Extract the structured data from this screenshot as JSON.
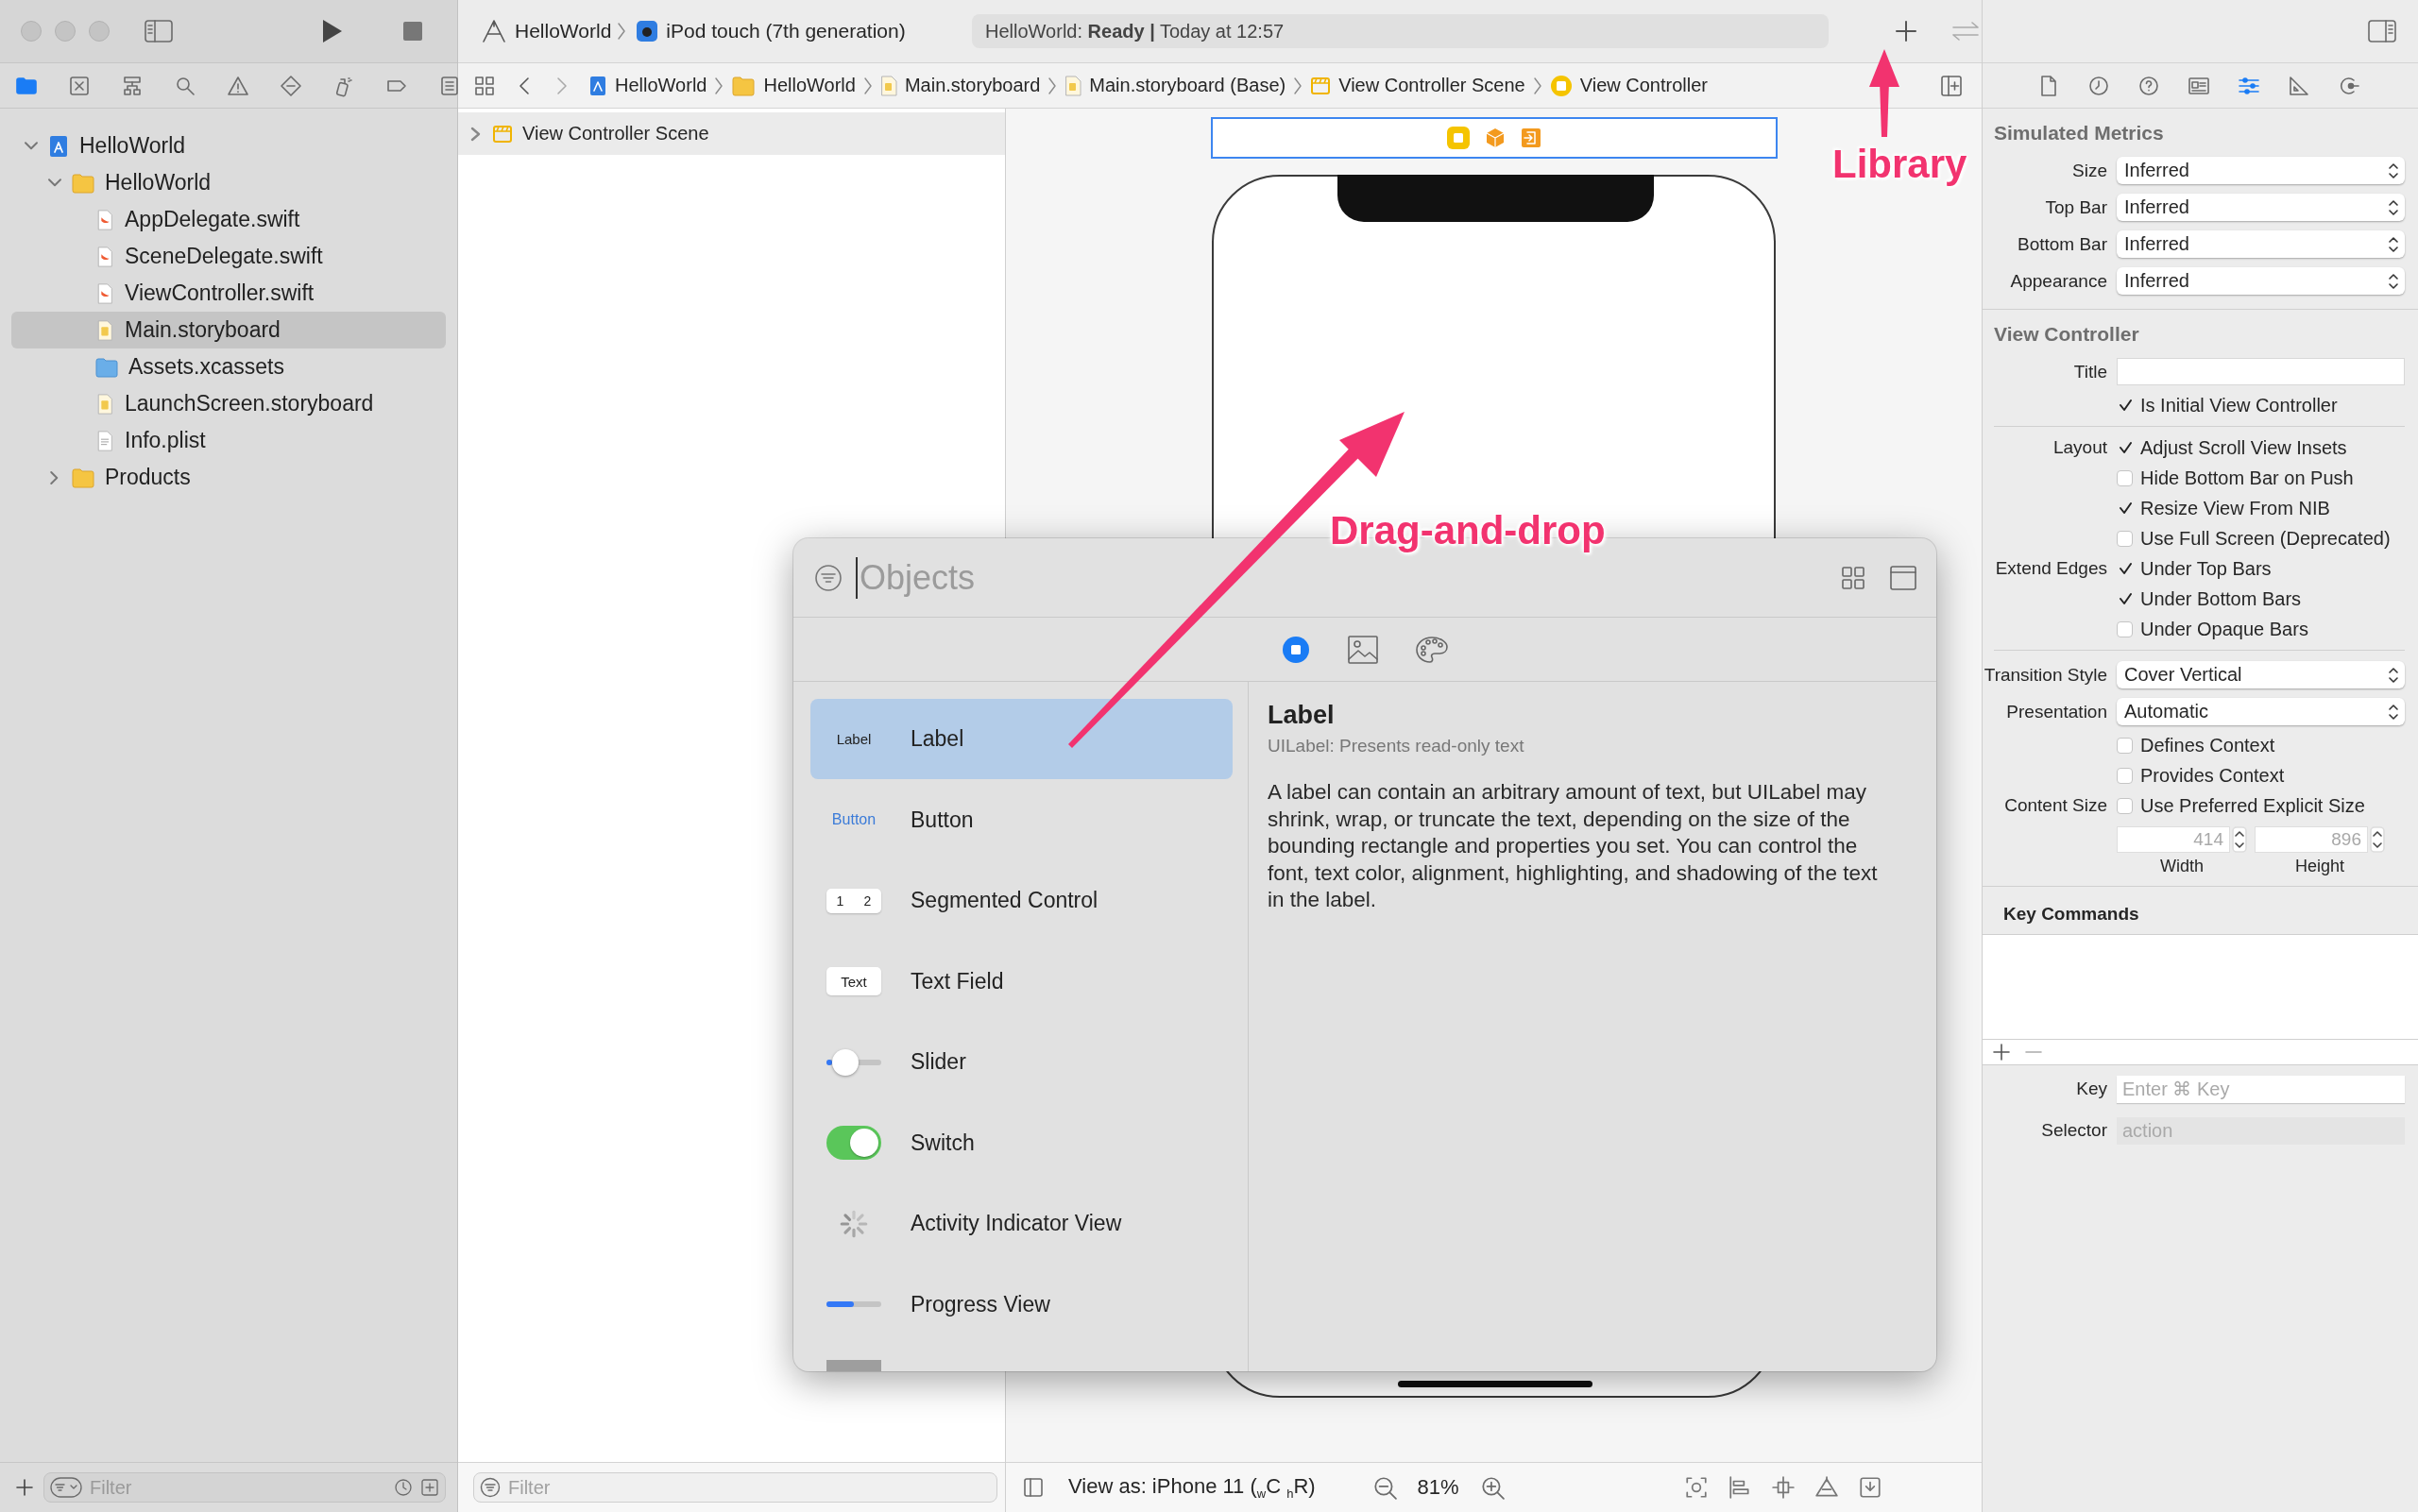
{
  "toolbar": {
    "scheme": "HelloWorld",
    "device": "iPod touch (7th generation)",
    "status": "HelloWorld: **Ready |** Today at 12:57"
  },
  "navigator": {
    "tabs": [
      {
        "kind": "folder",
        "selected": true
      },
      {
        "kind": "source-control",
        "selected": false
      },
      {
        "kind": "symbols",
        "selected": false
      },
      {
        "kind": "find",
        "selected": false
      },
      {
        "kind": "issues",
        "selected": false
      },
      {
        "kind": "tests",
        "selected": false
      },
      {
        "kind": "debug",
        "selected": false
      },
      {
        "kind": "breakpoints",
        "selected": false
      },
      {
        "kind": "reports",
        "selected": false
      }
    ],
    "tree": [
      {
        "name": "HelloWorld",
        "kind": "project",
        "expanded": true,
        "selected": false,
        "children": [
          {
            "name": "HelloWorld",
            "kind": "folder",
            "expanded": true,
            "selected": false,
            "children": [
              {
                "name": "AppDelegate.swift",
                "kind": "swift",
                "selected": false
              },
              {
                "name": "SceneDelegate.swift",
                "kind": "swift",
                "selected": false
              },
              {
                "name": "ViewController.swift",
                "kind": "swift",
                "selected": false
              },
              {
                "name": "Main.storyboard",
                "kind": "storyboard",
                "selected": true
              },
              {
                "name": "Assets.xcassets",
                "kind": "assets",
                "selected": false
              },
              {
                "name": "LaunchScreen.storyboard",
                "kind": "storyboard",
                "selected": false
              },
              {
                "name": "Info.plist",
                "kind": "plist",
                "selected": false
              }
            ]
          },
          {
            "name": "Products",
            "kind": "folder",
            "expanded": false,
            "selected": false
          }
        ]
      }
    ],
    "filter": {
      "placeholder": "Filter"
    }
  },
  "jump_bar": [
    {
      "label": "HelloWorld",
      "kind": "project"
    },
    {
      "label": "HelloWorld",
      "kind": "folder"
    },
    {
      "label": "Main.storyboard",
      "kind": "storyboard"
    },
    {
      "label": "Main.storyboard (Base)",
      "kind": "storyboard"
    },
    {
      "label": "View Controller Scene",
      "kind": "scene"
    },
    {
      "label": "View Controller",
      "kind": "controller"
    }
  ],
  "outline": {
    "items": [
      {
        "label": "View Controller Scene",
        "expanded": false
      }
    ],
    "filter": {
      "placeholder": "Filter"
    }
  },
  "canvas": {
    "view_as": "View as: iPhone 11 ($_{w}$C $_{h}$R)",
    "zoom": "81%"
  },
  "inspector": {
    "tabs": [
      {
        "kind": "file",
        "selected": false
      },
      {
        "kind": "history",
        "selected": false
      },
      {
        "kind": "help",
        "selected": false
      },
      {
        "kind": "identity",
        "selected": false
      },
      {
        "kind": "attributes",
        "selected": true
      },
      {
        "kind": "size",
        "selected": false
      },
      {
        "kind": "connections",
        "selected": false
      }
    ],
    "sections": [
      {
        "title": "Simulated Metrics",
        "rows": [
          {
            "kind": "popup",
            "label": "Size",
            "value": "Inferred"
          },
          {
            "kind": "popup",
            "label": "Top Bar",
            "value": "Inferred"
          },
          {
            "kind": "popup",
            "label": "Bottom Bar",
            "value": "Inferred"
          },
          {
            "kind": "popup",
            "label": "Appearance",
            "value": "Inferred"
          }
        ]
      },
      {
        "title": "View Controller",
        "rows": [
          {
            "kind": "field",
            "label": "Title"
          },
          {
            "kind": "checkbox",
            "text": "Is Initial View Controller",
            "checked": true
          },
          {
            "kind": "divider"
          },
          {
            "kind": "checkbox",
            "label": "Layout",
            "text": "Adjust Scroll View Insets",
            "checked": true
          },
          {
            "kind": "checkbox",
            "text": "Hide Bottom Bar on Push",
            "checked": false
          },
          {
            "kind": "checkbox",
            "text": "Resize View From NIB",
            "checked": true
          },
          {
            "kind": "checkbox",
            "text": "Use Full Screen (Deprecated)",
            "checked": false
          },
          {
            "kind": "checkbox",
            "label": "Extend Edges",
            "text": "Under Top Bars",
            "checked": true
          },
          {
            "kind": "checkbox",
            "text": "Under Bottom Bars",
            "checked": true
          },
          {
            "kind": "checkbox",
            "text": "Under Opaque Bars",
            "checked": false
          },
          {
            "kind": "divider"
          },
          {
            "kind": "popup",
            "label": "Transition Style",
            "value": "Cover Vertical"
          },
          {
            "kind": "popup",
            "label": "Presentation",
            "value": "Automatic"
          },
          {
            "kind": "checkbox",
            "text": "Defines Context",
            "checked": false
          },
          {
            "kind": "checkbox",
            "text": "Provides Context",
            "checked": false
          },
          {
            "kind": "checkbox",
            "label": "Content Size",
            "text": "Use Preferred Explicit Size",
            "checked": false
          },
          {
            "kind": "size-fields",
            "fields": [
              {
                "value": "414",
                "caption": "Width",
                "disabled": true
              },
              {
                "value": "896",
                "caption": "Height",
                "disabled": true
              }
            ]
          }
        ]
      }
    ],
    "key_commands": {
      "title": "Key Commands",
      "key": {
        "label": "Key",
        "placeholder": "Enter ⌘ Key",
        "disabled": false
      },
      "selector": {
        "label": "Selector",
        "placeholder": "action",
        "disabled": true
      }
    }
  },
  "library": {
    "search": {
      "placeholder": "Objects"
    },
    "tabs": [
      {
        "kind": "objects",
        "selected": true
      },
      {
        "kind": "images",
        "selected": false
      },
      {
        "kind": "colors",
        "selected": false
      }
    ],
    "items": [
      {
        "kind": "label",
        "name": "Label",
        "preview": "Label",
        "selected": true
      },
      {
        "kind": "button",
        "name": "Button",
        "preview": "Button",
        "selected": false
      },
      {
        "kind": "segmented",
        "name": "Segmented Control",
        "segments": [
          "1",
          "2"
        ],
        "selected": false
      },
      {
        "kind": "text-field",
        "name": "Text Field",
        "preview": "Text",
        "selected": false
      },
      {
        "kind": "slider",
        "name": "Slider",
        "level": 0.35,
        "selected": false
      },
      {
        "kind": "switch",
        "name": "Switch",
        "on": true,
        "selected": false
      },
      {
        "kind": "activity",
        "name": "Activity Indicator View",
        "selected": false
      },
      {
        "kind": "progress",
        "name": "Progress View",
        "level": 0.5,
        "selected": false
      },
      {
        "kind": "view",
        "selected": false
      }
    ],
    "detail": {
      "title": "Label",
      "subtitle": "UILabel: Presents read-only text",
      "description": "A label can contain an arbitrary amount of text, but UILabel may shrink, wrap, or truncate the text, depending on the size of the bounding rectangle and properties you set. You can control the font, text color, alignment, highlighting, and shadowing of the text in the label."
    }
  },
  "annotations": [
    {
      "kind": "library",
      "text": "Library"
    },
    {
      "kind": "drag",
      "text": "Drag-and-drop"
    }
  ]
}
